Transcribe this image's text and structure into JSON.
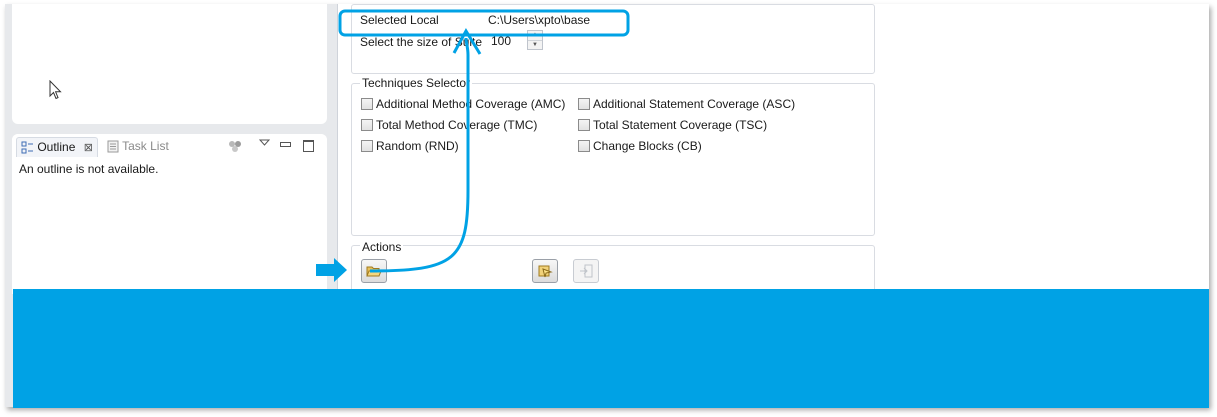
{
  "outline_view": {
    "tabs": [
      {
        "label": "Outline",
        "icon": "outline-icon",
        "close_icon": "close-icon"
      },
      {
        "label": "Task List",
        "icon": "task-list-icon"
      }
    ],
    "toolbar_icons": [
      "focus-icon",
      "view-menu-icon",
      "minimize-icon",
      "maximize-icon"
    ],
    "message": "An outline is not available."
  },
  "settings": {
    "selected_local_label": "Selected Local",
    "selected_local_value": "C:\\Users\\xpto\\base",
    "suite_size_label": "Select the size of Suite",
    "suite_size_value": "100"
  },
  "techniques_selector": {
    "title": "Techniques Selector",
    "options": [
      "Additional Method Coverage (AMC)",
      "Additional Statement Coverage (ASC)",
      "Total Method Coverage (TMC)",
      "Total Statement Coverage (TSC)",
      "Random (RND)",
      "Change Blocks (CB)"
    ]
  },
  "actions": {
    "title": "Actions",
    "buttons": [
      {
        "icon": "open-folder-icon",
        "enabled": true
      },
      {
        "icon": "run-icon",
        "enabled": true
      },
      {
        "icon": "export-icon",
        "enabled": false
      }
    ]
  },
  "colors": {
    "annotation_blue": "#00a2e5",
    "band": "#00a2e5"
  }
}
